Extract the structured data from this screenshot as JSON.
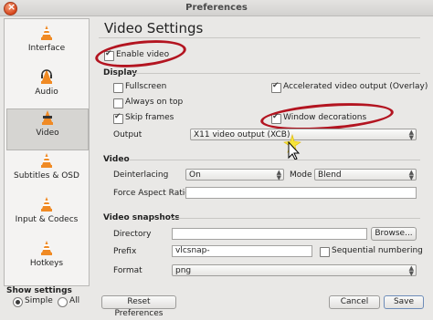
{
  "window": {
    "title": "Preferences"
  },
  "sidebar": {
    "items": [
      {
        "label": "Interface"
      },
      {
        "label": "Audio"
      },
      {
        "label": "Video"
      },
      {
        "label": "Subtitles & OSD"
      },
      {
        "label": "Input & Codecs"
      },
      {
        "label": "Hotkeys"
      }
    ],
    "selected": "Video"
  },
  "show_settings": {
    "label": "Show settings",
    "simple": "Simple",
    "all": "All",
    "selected": "Simple"
  },
  "main": {
    "title": "Video Settings",
    "enable_video": {
      "label": "Enable video",
      "checked": true
    },
    "display": {
      "header": "Display",
      "fullscreen": {
        "label": "Fullscreen",
        "checked": false
      },
      "always_on_top": {
        "label": "Always on top",
        "checked": false
      },
      "skip_frames": {
        "label": "Skip frames",
        "checked": true
      },
      "accelerated": {
        "label": "Accelerated video output (Overlay)",
        "checked": true
      },
      "window_decorations": {
        "label": "Window decorations",
        "checked": true
      },
      "output_label": "Output",
      "output_value": "X11 video output (XCB)"
    },
    "video": {
      "header": "Video",
      "deinterlacing_label": "Deinterlacing",
      "deinterlacing_value": "On",
      "mode_label": "Mode",
      "mode_value": "Blend",
      "aspect_label": "Force Aspect Ratio",
      "aspect_value": ""
    },
    "snapshots": {
      "header": "Video snapshots",
      "directory_label": "Directory",
      "directory_value": "",
      "browse_label": "Browse...",
      "prefix_label": "Prefix",
      "prefix_value": "vlcsnap-",
      "sequential": {
        "label": "Sequential numbering",
        "checked": false
      },
      "format_label": "Format",
      "format_value": "png"
    }
  },
  "footer": {
    "reset": "Reset Preferences",
    "cancel": "Cancel",
    "save": "Save"
  },
  "colors": {
    "annotation_ring": "#b31420",
    "cone_orange": "#f08a24"
  }
}
